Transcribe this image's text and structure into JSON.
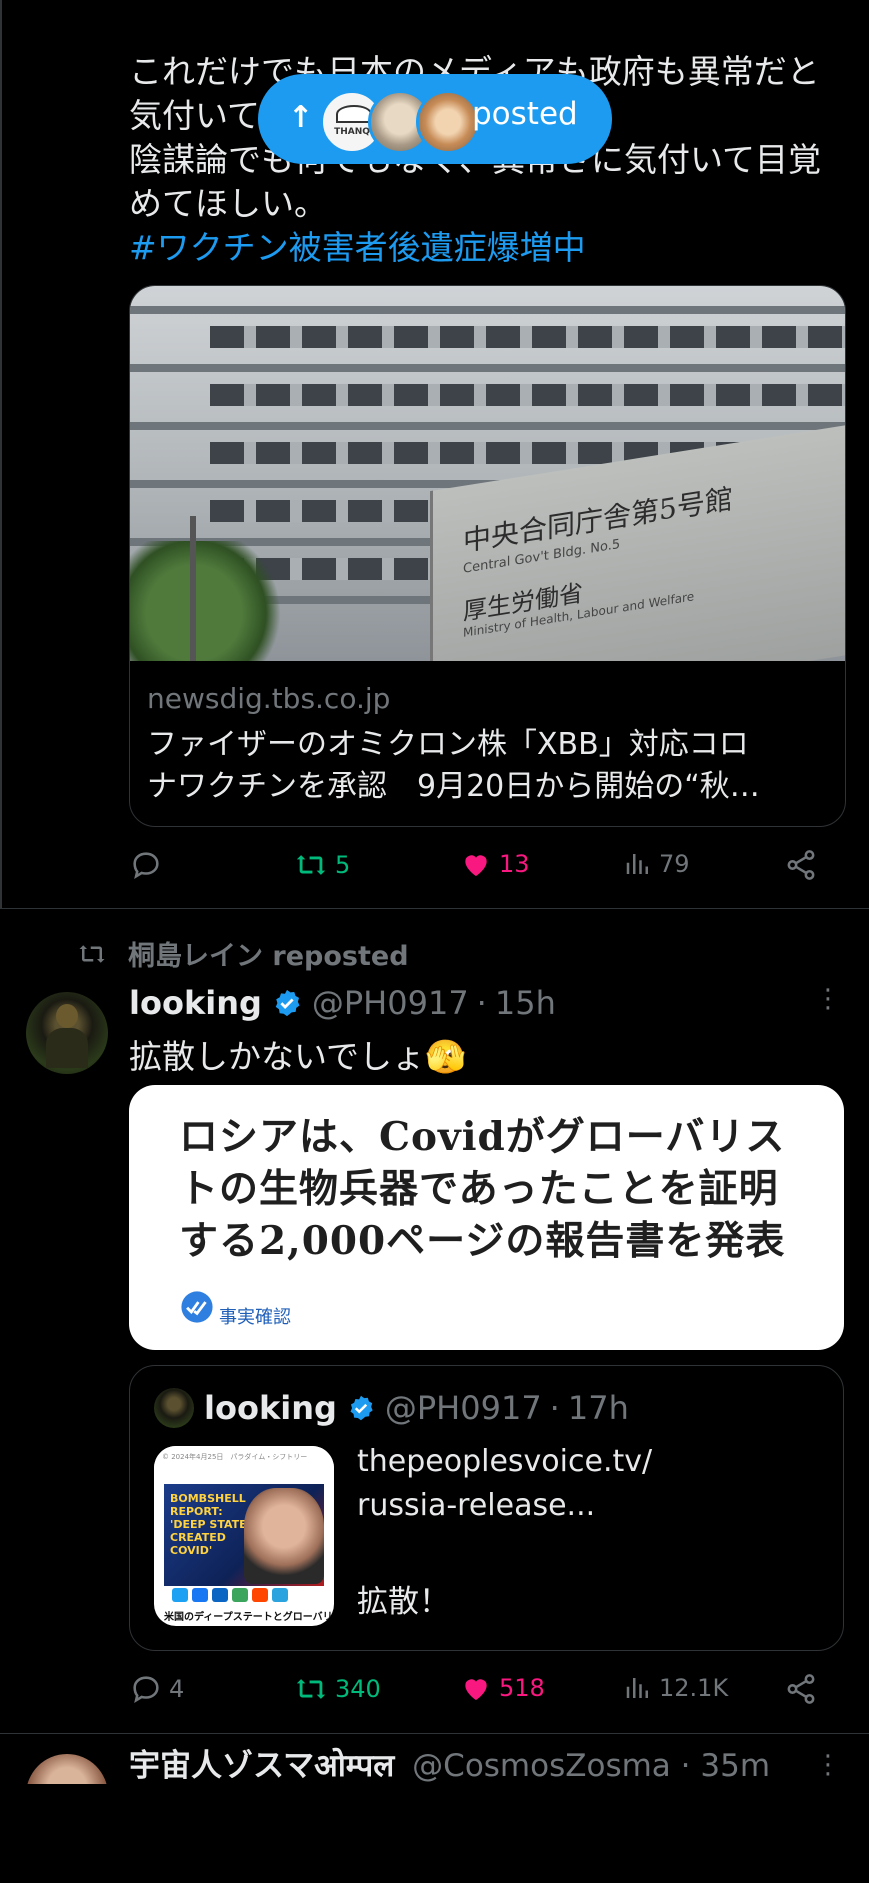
{
  "colors": {
    "accent": "#1d9bf0",
    "retweet": "#00ba7c",
    "like": "#f91880",
    "muted": "#71767b",
    "text": "#e7e9ea",
    "bg": "#000000"
  },
  "post1": {
    "text_lines": [
      "これだけでも日本のメディアも政府も異常だと",
      "気付いてほしい。",
      "陰謀論でも何でもなく、異常さに気付いて目覚",
      "めてほしい。"
    ],
    "hashtag": "#ワクチン被害者後遺症爆増中",
    "card": {
      "image_icon": "ministry-building-photo",
      "sign_name": "中央合同庁舎第5号館",
      "sign_name_en": "Central Gov't Bldg. No.5",
      "sign_ministry": "厚生労働省",
      "sign_ministry_en": "Ministry of Health, Labour and Welfare",
      "domain": "newsdig.tbs.co.jp",
      "title_line1": "ファイザーのオミクロン株「XBB」対応コロ",
      "title_line2": "ナワクチンを承認　9月20日から開始の“秋…"
    },
    "actions": {
      "replies": "",
      "reposts": "5",
      "likes": "13",
      "views": "79"
    }
  },
  "new_posts_pill": {
    "label": "posted",
    "arrow": "↑",
    "avatars": [
      "thanq-avatar",
      "alpaca-avatar",
      "cat-avatar"
    ],
    "avatar1_text": "THANQ"
  },
  "post2": {
    "repost_by": "桐島レイン reposted",
    "author": {
      "name": "looking",
      "handle": "@PH0917",
      "time": "15h",
      "avatar": "looking-avatar"
    },
    "text": "拡散しかないでしょ🫣",
    "headline_image": {
      "lines": [
        "ロシアは、Covidがグローバリス",
        "トの生物兵器であったことを証明",
        "する2,000ページの報告書を発表"
      ],
      "badge": "事実確認"
    },
    "quote": {
      "author": {
        "name": "looking",
        "handle": "@PH0917",
        "time": "17h"
      },
      "link_line1": "thepeoplesvoice.tv/",
      "link_line2": "russia-release...",
      "text": "拡散！",
      "thumb": {
        "title": "BOMBSHELL REPORT: 'DEEP STATE CREATED COVID'",
        "caption": "米国のディープステートとグローバリスト",
        "top_small": "© 2024年4月25日　パラダイム・シフトリー"
      }
    },
    "actions": {
      "replies": "4",
      "reposts": "340",
      "likes": "518",
      "views": "12.1K"
    }
  },
  "post3": {
    "author": {
      "name": "宇宙人ゾスマ",
      "name_suffix": "ओम्पल",
      "handle": "@CosmosZosma",
      "time": "35m"
    }
  }
}
